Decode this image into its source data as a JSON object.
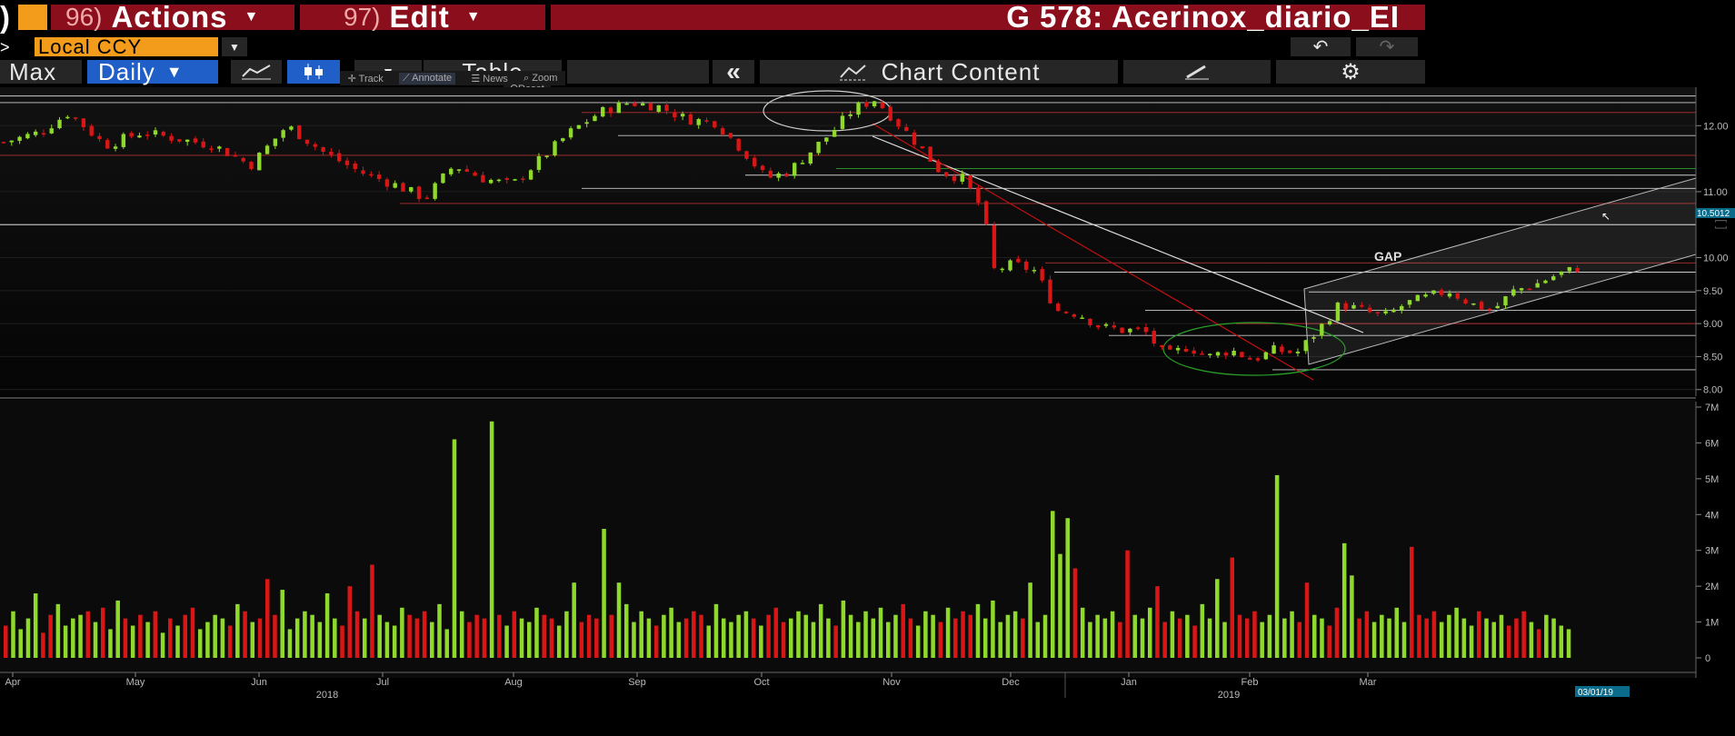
{
  "toolbar": {
    "left_stub": ")",
    "actions_num": "96)",
    "actions_label": "Actions",
    "edit_num": "97)",
    "edit_label": "Edit",
    "title": "G 578: Acerinox_diario_EI",
    "nav_stub": ">",
    "currency": "Local CCY",
    "range": "Max",
    "period": "Daily",
    "table_label": "Table",
    "collapse_label": "«",
    "chart_content_label": "Chart Content"
  },
  "mini_toolbar": {
    "track": "Track",
    "annotate": "Annotate",
    "news": "News",
    "zoom": "Zoom",
    "reset": "Reset"
  },
  "annotations": {
    "gap": "GAP",
    "last_price": "10.5012",
    "cursor_date": "03/01/19"
  },
  "colors": {
    "bull": "#8fd92c",
    "bear": "#d81616",
    "accent_orange": "#f39c1c",
    "active_blue": "#1f5fc7",
    "title_red": "#8a0e1b"
  },
  "chart_data": {
    "type": "candlestick",
    "price_axis": {
      "ticks": [
        "12.00",
        "11.00",
        "10.00",
        "9.50",
        "9.00",
        "8.50",
        "8.00"
      ],
      "ylim": [
        7.9,
        12.5
      ]
    },
    "volume_axis": {
      "ticks": [
        "7M",
        "6M",
        "5M",
        "4M",
        "3M",
        "2M",
        "1M",
        "0"
      ],
      "ylim": [
        0,
        7
      ]
    },
    "x_months": [
      "Apr",
      "May",
      "Jun",
      "Jul",
      "Aug",
      "Sep",
      "Oct",
      "Nov",
      "Dec",
      "Jan",
      "Feb",
      "Mar"
    ],
    "x_years": [
      "2018",
      "2019"
    ],
    "close_path": [
      [
        0,
        11.75
      ],
      [
        10,
        11.9
      ],
      [
        18,
        12.2
      ],
      [
        28,
        11.7
      ],
      [
        38,
        11.9
      ],
      [
        48,
        11.8
      ],
      [
        58,
        11.7
      ],
      [
        68,
        11.4
      ],
      [
        78,
        12.0
      ],
      [
        88,
        11.6
      ],
      [
        98,
        11.3
      ],
      [
        108,
        11.1
      ],
      [
        116,
        10.9
      ],
      [
        124,
        11.4
      ],
      [
        132,
        11.2
      ],
      [
        140,
        11.1
      ],
      [
        148,
        11.5
      ],
      [
        156,
        11.9
      ],
      [
        164,
        12.2
      ],
      [
        172,
        12.35
      ],
      [
        180,
        12.3
      ],
      [
        188,
        12.1
      ],
      [
        196,
        12.05
      ],
      [
        204,
        11.6
      ],
      [
        210,
        11.2
      ],
      [
        216,
        11.3
      ],
      [
        222,
        11.6
      ],
      [
        228,
        11.9
      ],
      [
        234,
        12.25
      ],
      [
        240,
        12.4
      ],
      [
        246,
        12.05
      ],
      [
        252,
        11.7
      ],
      [
        258,
        11.3
      ],
      [
        264,
        11.2
      ],
      [
        270,
        10.7
      ],
      [
        272,
        9.8
      ],
      [
        278,
        9.9
      ],
      [
        284,
        9.8
      ],
      [
        290,
        9.2
      ],
      [
        296,
        9.15
      ],
      [
        302,
        8.95
      ],
      [
        308,
        8.9
      ],
      [
        314,
        8.9
      ],
      [
        320,
        8.5
      ],
      [
        326,
        8.65
      ],
      [
        332,
        8.5
      ],
      [
        338,
        8.6
      ],
      [
        344,
        8.45
      ],
      [
        350,
        8.6
      ],
      [
        356,
        8.55
      ],
      [
        362,
        8.9
      ],
      [
        368,
        9.3
      ],
      [
        374,
        9.2
      ],
      [
        380,
        9.1
      ],
      [
        386,
        9.3
      ],
      [
        392,
        9.4
      ],
      [
        398,
        9.5
      ],
      [
        404,
        9.3
      ],
      [
        410,
        9.2
      ],
      [
        416,
        9.5
      ],
      [
        422,
        9.6
      ],
      [
        428,
        9.75
      ],
      [
        434,
        9.85
      ]
    ],
    "volumes_M": [
      0.9,
      1.3,
      0.8,
      1.1,
      1.8,
      0.7,
      1.2,
      1.5,
      0.9,
      1.1,
      1.2,
      1.3,
      1.0,
      1.4,
      0.8,
      1.6,
      1.1,
      0.9,
      1.2,
      1.0,
      1.3,
      0.7,
      1.1,
      0.9,
      1.2,
      1.4,
      0.8,
      1.0,
      1.2,
      1.1,
      0.9,
      1.5,
      1.3,
      1.0,
      1.1,
      2.2,
      1.2,
      1.9,
      0.8,
      1.1,
      1.3,
      1.2,
      1.0,
      1.8,
      1.1,
      0.9,
      2.0,
      1.3,
      1.1,
      2.6,
      1.2,
      1.0,
      0.9,
      1.4,
      1.2,
      1.1,
      1.3,
      1.0,
      1.5,
      0.8,
      6.1,
      1.3,
      1.0,
      1.2,
      1.1,
      6.6,
      1.2,
      0.9,
      1.3,
      1.1,
      1.0,
      1.4,
      1.2,
      1.1,
      0.9,
      1.3,
      2.1,
      1.0,
      1.2,
      1.1,
      3.6,
      1.2,
      2.1,
      1.5,
      1.0,
      1.3,
      1.1,
      0.9,
      1.2,
      1.4,
      1.0,
      1.1,
      1.3,
      1.2,
      0.9,
      1.5,
      1.1,
      1.0,
      1.2,
      1.3,
      1.1,
      0.9,
      1.2,
      1.4,
      1.0,
      1.1,
      1.3,
      1.2,
      1.0,
      1.5,
      1.1,
      0.9,
      1.6,
      1.2,
      1.0,
      1.3,
      1.1,
      1.4,
      1.0,
      1.2,
      1.5,
      1.1,
      0.9,
      1.3,
      1.2,
      1.0,
      1.4,
      1.1,
      1.3,
      1.2,
      1.5,
      1.1,
      1.6,
      1.0,
      1.2,
      1.3,
      1.1,
      2.1,
      1.0,
      1.2,
      4.1,
      2.9,
      3.9,
      2.5,
      1.4,
      1.0,
      1.2,
      1.1,
      1.3,
      1.0,
      3.0,
      1.2,
      1.1,
      1.4,
      2.0,
      1.0,
      1.3,
      1.1,
      1.2,
      0.9,
      1.5,
      1.1,
      2.2,
      1.0,
      2.8,
      1.2,
      1.1,
      1.3,
      1.0,
      1.2,
      5.1,
      1.1,
      1.3,
      1.0,
      2.1,
      1.2,
      1.1,
      0.9,
      1.4,
      3.2,
      2.3,
      1.1,
      1.3,
      1.0,
      1.2,
      1.1,
      1.4,
      1.0,
      3.1,
      1.2,
      1.1,
      1.3,
      1.0,
      1.2,
      1.4,
      1.1,
      0.9,
      1.3,
      1.1,
      1.0,
      1.2,
      0.9,
      1.1,
      1.3,
      1.0,
      0.8,
      1.2,
      1.1,
      0.9,
      0.8
    ]
  }
}
